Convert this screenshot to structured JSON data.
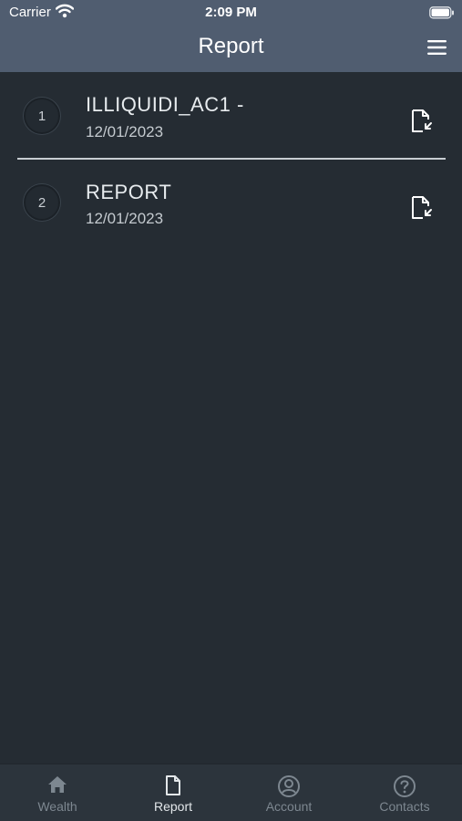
{
  "status_bar": {
    "carrier": "Carrier",
    "time": "2:09 PM"
  },
  "header": {
    "title": "Report"
  },
  "reports": [
    {
      "index": "1",
      "name": "ILLIQUIDI_AC1 -",
      "date": "12/01/2023"
    },
    {
      "index": "2",
      "name": "REPORT",
      "date": "12/01/2023"
    }
  ],
  "tabs": [
    {
      "label": "Wealth",
      "icon": "home-icon"
    },
    {
      "label": "Report",
      "icon": "document-icon",
      "active": true
    },
    {
      "label": "Account",
      "icon": "user-circle-icon"
    },
    {
      "label": "Contacts",
      "icon": "help-circle-icon"
    }
  ],
  "colors": {
    "header": "#505d70",
    "background": "#252c33",
    "tabbar": "#2c343c",
    "tab_active": "#e3e7ea",
    "tab_inactive": "#7d8790"
  }
}
